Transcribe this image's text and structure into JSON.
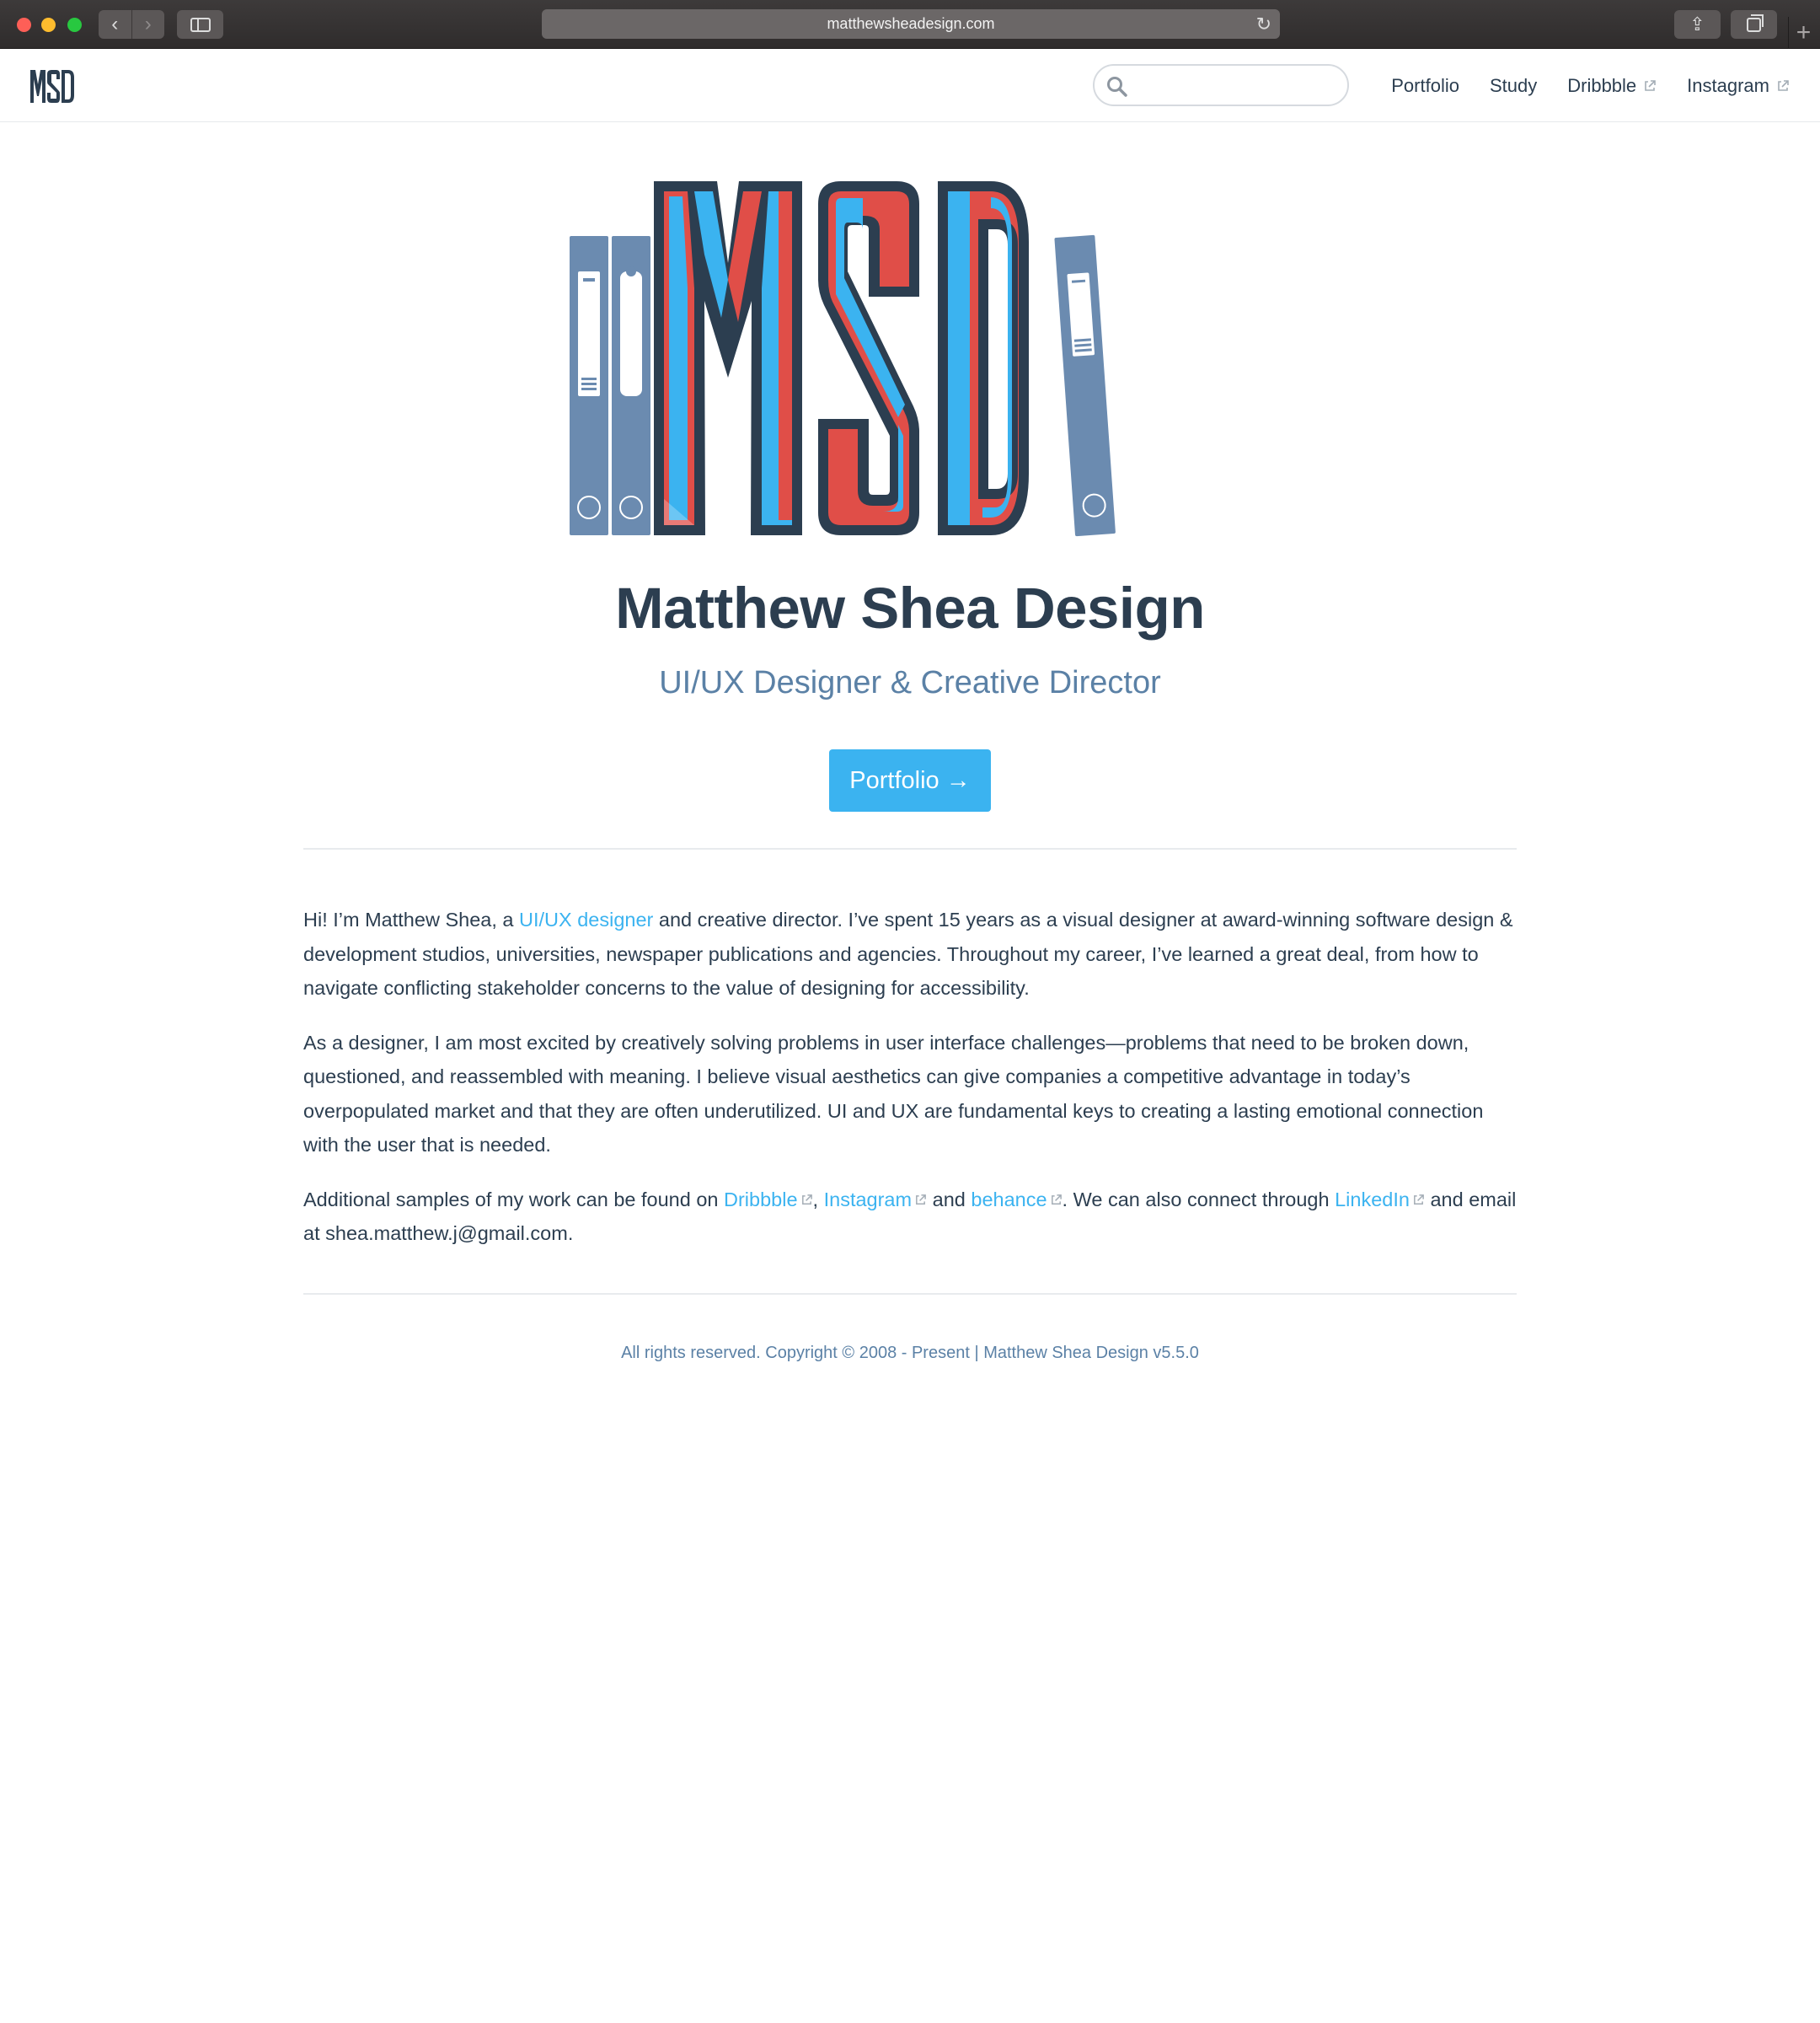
{
  "browser": {
    "url": "matthewsheadesign.com",
    "back_icon": "chevron-left-icon",
    "forward_icon": "chevron-right-icon",
    "reload_icon": "reload-icon",
    "share_icon": "share-icon",
    "tabs_icon": "tabs-icon",
    "new_tab_icon": "plus-icon"
  },
  "header": {
    "logo_text": "MSD",
    "search": {
      "placeholder": "",
      "value": ""
    },
    "nav": [
      {
        "label": "Portfolio",
        "external": false
      },
      {
        "label": "Study",
        "external": false
      },
      {
        "label": "Dribbble",
        "external": true
      },
      {
        "label": "Instagram",
        "external": true
      }
    ]
  },
  "hero": {
    "title": "Matthew Shea Design",
    "subtitle": "UI/UX Designer & Creative Director",
    "cta_label": "Portfolio →"
  },
  "about": {
    "p1_before": "Hi! I’m Matthew Shea, a ",
    "p1_link": "UI/UX designer",
    "p1_after": " and creative director. I’ve spent 15 years as a visual designer at award-winning software design & development studios, universities, newspaper publications and agencies. Throughout my career, I’ve learned a great deal, from how to navigate conflicting stakeholder concerns to the value of designing for accessibility.",
    "p2": "As a designer, I am most excited by creatively solving problems in user interface challenges—problems that need to be broken down, questioned, and reassembled with meaning. I believe visual aesthetics can give companies a competitive advantage in today’s overpopulated market and that they are often underutilized. UI and UX are fundamental keys to creating a lasting emotional connection with the user that is needed.",
    "p3_start": "Additional samples of my work can be found on ",
    "link_dribbble": "Dribbble",
    "sep_comma": ", ",
    "link_instagram": "Instagram",
    "sep_and": " and ",
    "link_behance": "behance",
    "p3_mid": ". We can also connect through ",
    "link_linkedin": "LinkedIn",
    "p3_end": " and email at shea.matthew.j@gmail.com."
  },
  "footer": {
    "text": "All rights reserved. Copyright © 2008 - Present | Matthew Shea Design v5.5.0"
  },
  "colors": {
    "navy": "#2c3e50",
    "accent_blue": "#3bb3f0",
    "red": "#e04e48",
    "binder_blue": "#6b8bb0",
    "muted_blue": "#5b81a6"
  }
}
